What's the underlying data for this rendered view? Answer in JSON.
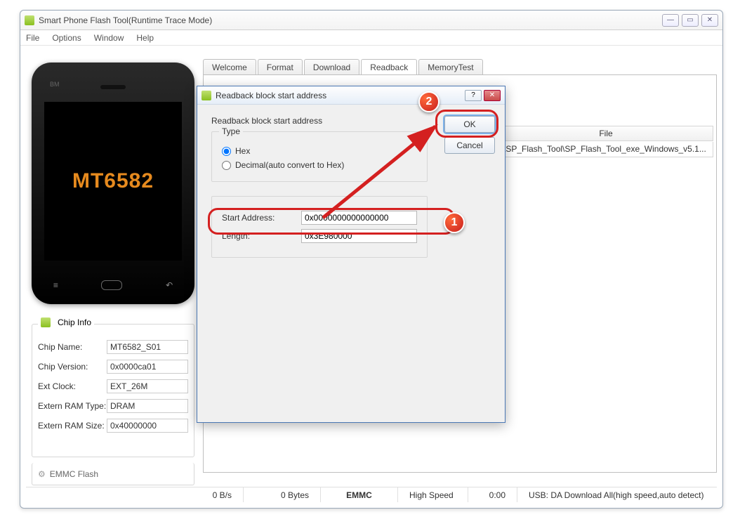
{
  "window": {
    "title": "Smart Phone Flash Tool(Runtime Trace Mode)"
  },
  "menu": {
    "file": "File",
    "options": "Options",
    "window": "Window",
    "help": "Help"
  },
  "phone": {
    "model": "MT6582",
    "bm": "BM"
  },
  "chip_info": {
    "header": "Chip Info",
    "fields": [
      {
        "label": "Chip Name:",
        "value": "MT6582_S01"
      },
      {
        "label": "Chip Version:",
        "value": "0x0000ca01"
      },
      {
        "label": "Ext Clock:",
        "value": "EXT_26M"
      },
      {
        "label": "Extern RAM Type:",
        "value": "DRAM"
      },
      {
        "label": "Extern RAM Size:",
        "value": "0x40000000"
      }
    ]
  },
  "emmc": {
    "label": "EMMC Flash"
  },
  "tabs": {
    "welcome": "Welcome",
    "format": "Format",
    "download": "Download",
    "readback": "Readback",
    "memtest": "MemoryTest"
  },
  "file_table": {
    "header": "File",
    "row0": "\\SP_Flash_Tool\\SP_Flash_Tool_exe_Windows_v5.1..."
  },
  "status": {
    "rate": "0 B/s",
    "bytes": "0 Bytes",
    "storage": "EMMC",
    "speed": "High Speed",
    "time": "0:00",
    "usb": "USB: DA Download All(high speed,auto detect)"
  },
  "dialog": {
    "title": "Readback block start address",
    "heading": "Readback block start address",
    "type_label": "Type",
    "hex": "Hex",
    "decimal": "Decimal(auto convert to Hex)",
    "start_label": "Start Address:",
    "start_value": "0x0000000000000000",
    "length_label": "Length:",
    "length_value": "0x3E980000",
    "ok": "OK",
    "cancel": "Cancel",
    "help": "?",
    "close": "✕"
  },
  "annotations": {
    "n1": "1",
    "n2": "2"
  }
}
